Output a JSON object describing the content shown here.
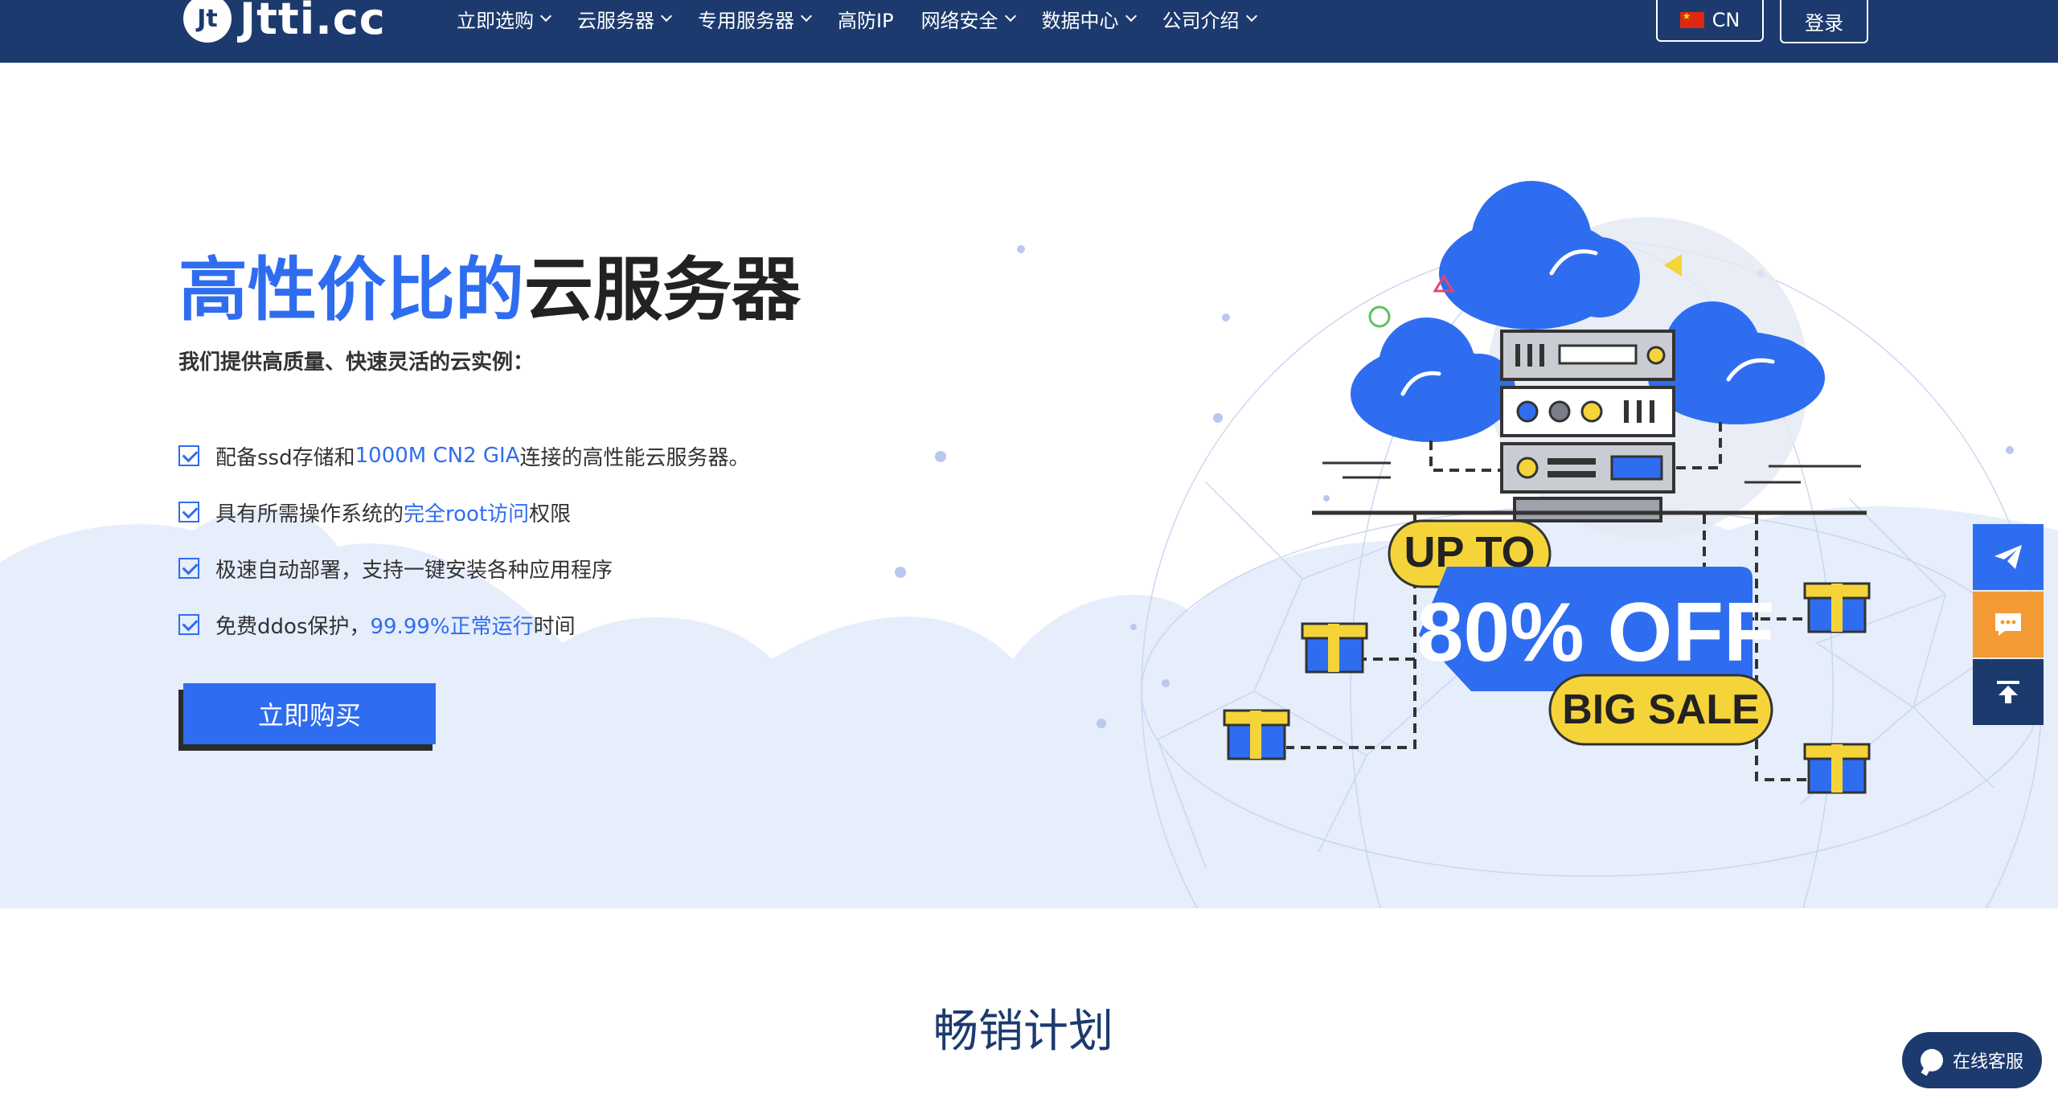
{
  "nav": {
    "logo_mark": "Jt",
    "logo_text": "Jtti.cc",
    "items": [
      {
        "label": "立即选购",
        "dropdown": true
      },
      {
        "label": "云服务器",
        "dropdown": true
      },
      {
        "label": "专用服务器",
        "dropdown": true
      },
      {
        "label": "高防IP",
        "dropdown": false
      },
      {
        "label": "网络安全",
        "dropdown": true
      },
      {
        "label": "数据中心",
        "dropdown": true
      },
      {
        "label": "公司介绍",
        "dropdown": true
      }
    ],
    "language": "CN",
    "login": "登录"
  },
  "hero": {
    "title_highlight": "高性价比的",
    "title_rest": "云服务器",
    "subtitle": "我们提供高质量、快速灵活的云实例：",
    "features": [
      {
        "before": "配备ssd存储和",
        "highlight": "1000M CN2 GIA",
        "after": "连接的高性能云服务器。"
      },
      {
        "before": "具有所需操作系统的",
        "highlight": "完全root访问",
        "after": "权限"
      },
      {
        "before": "极速自动部署，支持一键安装各种应用程序",
        "highlight": "",
        "after": ""
      },
      {
        "before": "免费ddos保护，",
        "highlight": "99.99%正常运行",
        "after": "时间"
      }
    ],
    "buy_button": "立即购买",
    "promo": {
      "line1": "UP TO",
      "line2": "80% OFF",
      "line3": "BIG SALE"
    }
  },
  "side_tools": [
    {
      "icon": "paper-plane-icon"
    },
    {
      "icon": "message-icon"
    },
    {
      "icon": "back-to-top-icon"
    }
  ],
  "bestsellers": {
    "title": "畅销计划"
  },
  "chat": {
    "label": "在线客服"
  },
  "colors": {
    "nav_bg": "#1c3a6e",
    "accent_blue": "#2f6df0",
    "orange": "#f39a35",
    "promo_yellow": "#f5d43a"
  }
}
